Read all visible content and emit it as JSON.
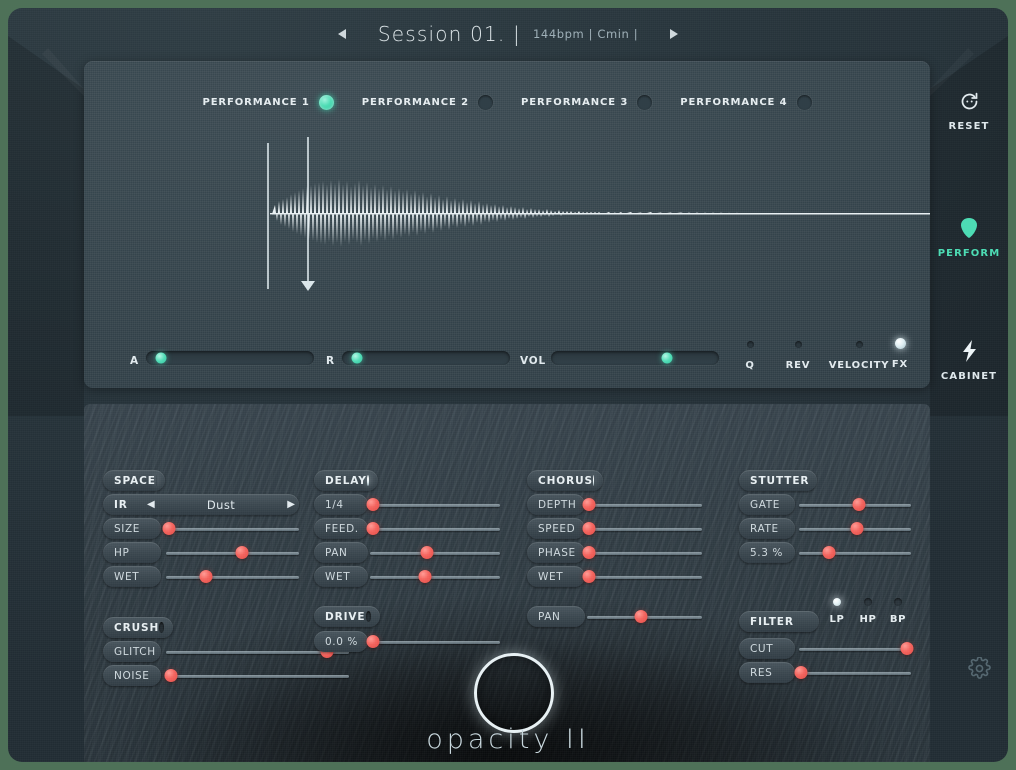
{
  "header": {
    "prev_icon": "triangle-left-icon",
    "next_icon": "triangle-right-icon",
    "title": "Session 01. |",
    "meta": "144bpm | Cmin |"
  },
  "performances": [
    {
      "label": "PERFORMANCE 1",
      "active": true
    },
    {
      "label": "PERFORMANCE 2",
      "active": false
    },
    {
      "label": "PERFORMANCE 3",
      "active": false
    },
    {
      "label": "PERFORMANCE 4",
      "active": false
    }
  ],
  "display_sliders": [
    {
      "label": "A",
      "value": 3
    },
    {
      "label": "R",
      "value": 4
    },
    {
      "label": "VOL",
      "value": 71
    }
  ],
  "display_toggles": [
    {
      "label": "Q",
      "on": false
    },
    {
      "label": "REV",
      "on": false
    },
    {
      "label": "VELOCITY",
      "on": false
    },
    {
      "label": "FX",
      "on": true
    }
  ],
  "rail": [
    {
      "label": "RESET",
      "icon": "reset-icon",
      "active": false
    },
    {
      "label": "PERFORM",
      "icon": "pick-icon",
      "active": true
    },
    {
      "label": "CABINET",
      "icon": "bolt-icon",
      "active": false
    }
  ],
  "settings": {
    "icon": "gear-icon"
  },
  "fx": {
    "space": {
      "title": "SPACE",
      "enabled": true,
      "ir": {
        "label": "IR",
        "value": "Dust",
        "prev_icon": "triangle-left-icon",
        "next_icon": "triangle-right-icon"
      },
      "params": [
        {
          "label": "SIZE",
          "value": 2
        },
        {
          "label": "HP",
          "value": 57
        },
        {
          "label": "WET",
          "value": 30
        }
      ]
    },
    "crush": {
      "title": "CRUSH",
      "enabled": false,
      "params": [
        {
          "label": "GLITCH",
          "value": 88
        },
        {
          "label": "NOISE",
          "value": 3
        }
      ]
    },
    "delay": {
      "title": "DELAY",
      "enabled": true,
      "params": [
        {
          "label": "1/4",
          "value": 2
        },
        {
          "label": "FEED.",
          "value": 2
        },
        {
          "label": "PAN",
          "value": 44
        },
        {
          "label": "WET",
          "value": 42
        }
      ]
    },
    "drive": {
      "title": "DRIVE",
      "enabled": false,
      "params": [
        {
          "label": "0.0 %",
          "value": 2
        }
      ]
    },
    "chorus": {
      "title": "CHORUS",
      "enabled": true,
      "params": [
        {
          "label": "DEPTH",
          "value": 2
        },
        {
          "label": "SPEED",
          "value": 2
        },
        {
          "label": "PHASE",
          "value": 2
        },
        {
          "label": "WET",
          "value": 2
        }
      ],
      "pan": {
        "label": "PAN",
        "value": 47
      }
    },
    "stutter": {
      "title": "STUTTER",
      "enabled": false,
      "params": [
        {
          "label": "GATE",
          "value": 54
        },
        {
          "label": "RATE",
          "value": 52
        },
        {
          "label": "5.3 %",
          "value": 27
        }
      ]
    },
    "filter": {
      "title": "FILTER",
      "modes": [
        {
          "label": "LP",
          "on": true
        },
        {
          "label": "HP",
          "on": false
        },
        {
          "label": "BP",
          "on": false
        }
      ],
      "params": [
        {
          "label": "CUT",
          "value": 96
        },
        {
          "label": "RES",
          "value": 2
        }
      ]
    }
  },
  "branding": {
    "logo": "opacity II"
  },
  "colors": {
    "accent_green": "#4ddcb4",
    "accent_red": "#f4635d",
    "panel_bg": "#36454d",
    "window_bg": "#27343b",
    "desk_bg": "#4e7158"
  }
}
